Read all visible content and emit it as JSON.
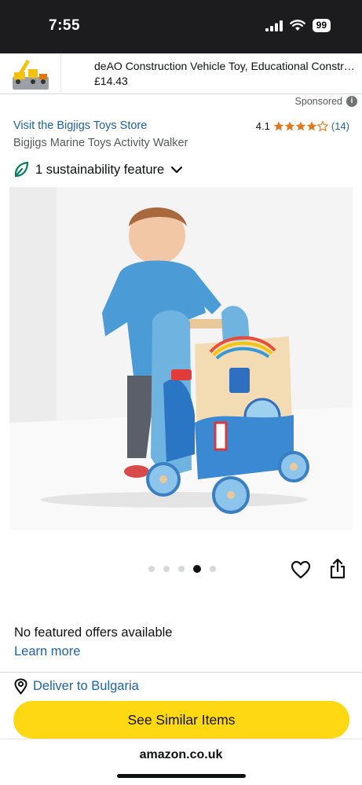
{
  "status_bar": {
    "time": "7:55",
    "battery": "99"
  },
  "ad": {
    "title": "deAO Construction Vehicle Toy, Educational Constructi...",
    "price": "£14.43",
    "sponsored_label": "Sponsored",
    "info_icon": "i"
  },
  "store": {
    "link": "Visit the Bigjigs Toys Store",
    "rating": "4.1",
    "rating_count": "(14)",
    "stars_filled": 4
  },
  "product": {
    "title": "Bigjigs Marine Toys Activity Walker"
  },
  "sustainability": {
    "label": "1 sustainability feature"
  },
  "gallery": {
    "count": 5,
    "active_index": 3
  },
  "offers": {
    "message": "No featured offers available",
    "learn_more": "Learn more"
  },
  "delivery": {
    "label": "Deliver to Bulgaria"
  },
  "cta": {
    "label": "See Similar Items"
  },
  "browser": {
    "domain": "amazon.co.uk"
  },
  "colors": {
    "link": "#2162a1",
    "star": "#de7921",
    "cta": "#ffd814",
    "leaf": "#067d62"
  },
  "icons": [
    "signal-icon",
    "wifi-icon",
    "battery-icon",
    "info-icon",
    "star-icon",
    "leaf-icon",
    "chevron-down-icon",
    "heart-icon",
    "share-icon",
    "location-pin-icon"
  ]
}
